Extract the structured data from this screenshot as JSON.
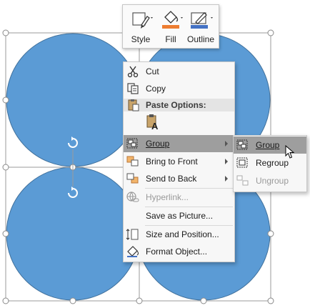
{
  "mini_toolbar": {
    "style_label": "Style",
    "fill_label": "Fill",
    "outline_label": "Outline",
    "fill_color": "#ed7d31",
    "outline_color": "#4472c4"
  },
  "shape": {
    "fill_color": "#5b9bd5",
    "outline_color": "#41719c"
  },
  "context_menu": {
    "cut": "Cut",
    "copy": "Copy",
    "paste_options_header": "Paste Options:",
    "group": "Group",
    "bring_to_front": "Bring to Front",
    "send_to_back": "Send to Back",
    "hyperlink": "Hyperlink...",
    "save_as_picture": "Save as Picture...",
    "size_and_position": "Size and Position...",
    "format_object": "Format Object..."
  },
  "group_submenu": {
    "group": "Group",
    "regroup": "Regroup",
    "ungroup": "Ungroup"
  }
}
